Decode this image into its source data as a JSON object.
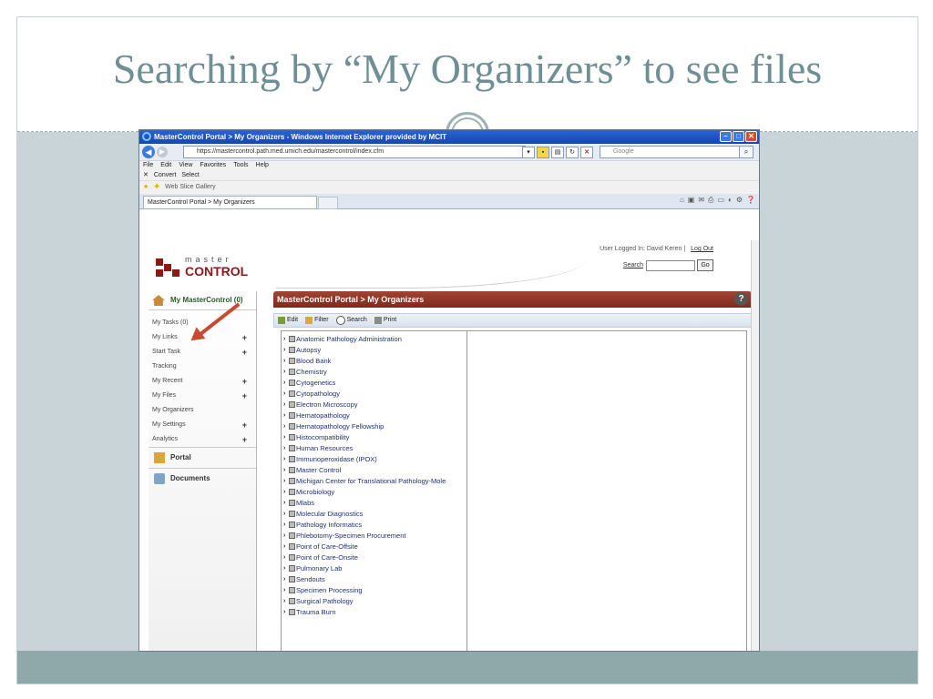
{
  "slide": {
    "title": "Searching by “My Organizers” to see files"
  },
  "browser": {
    "window_title": "MasterControl Portal > My Organizers - Windows Internet Explorer provided by MCIT",
    "url": "https://mastercontrol.path.med.umich.edu/mastercontrol/index.cfm",
    "search_placeholder": "Google",
    "menu": [
      "File",
      "Edit",
      "View",
      "Favorites",
      "Tools",
      "Help"
    ],
    "command_items": [
      "Convert",
      "Select"
    ],
    "favorites": [
      "Web Slice Gallery"
    ],
    "tab_label": "MasterControl Portal > My Organizers"
  },
  "portal": {
    "logo_top": "master",
    "logo_bottom": "CONTROL",
    "user_logged_in": "User Logged In: David Keren",
    "logout": "Log Out",
    "search_link": "Search",
    "go": "Go",
    "sidebar_header": "My MasterControl (0)",
    "sidebar_items": [
      {
        "label": "My Tasks (0)",
        "plus": false
      },
      {
        "label": "My Links",
        "plus": true
      },
      {
        "label": "Start Task",
        "plus": true
      },
      {
        "label": "Tracking",
        "plus": false
      },
      {
        "label": "My Recent",
        "plus": true
      },
      {
        "label": "My Files",
        "plus": true
      },
      {
        "label": "My Organizers",
        "plus": false
      },
      {
        "label": "My Settings",
        "plus": true
      },
      {
        "label": "Analytics",
        "plus": true
      }
    ],
    "sections": [
      "Portal",
      "Documents"
    ],
    "main_title": "MasterControl Portal > My Organizers",
    "toolbar": [
      "Edit",
      "Filter",
      "Search",
      "Print"
    ],
    "folders": [
      "Anatomic Pathology Administration",
      "Autopsy",
      "Blood Bank",
      "Chemistry",
      "Cytogenetics",
      "Cytopathology",
      "Electron Microscopy",
      "Hematopathology",
      "Hematopathology Fellowship",
      "Histocompatibility",
      "Human Resources",
      "Immunoperoxidase (IPOX)",
      "Master Control",
      "Michigan Center for Translational Pathology-Mole",
      "Microbiology",
      "Mlabs",
      "Molecular Diagnostics",
      "Pathology Informatics",
      "Phlebotomy-Specimen Procurement",
      "Point of Care-Offsite",
      "Point of Care-Onsite",
      "Pulmonary Lab",
      "Sendouts",
      "Specimen Processing",
      "Surgical Pathology",
      "Trauma Burn"
    ]
  },
  "colors": {
    "title": "#6e8f94",
    "band": "#c9d4d8",
    "footer": "#8fa9ab",
    "header_bar": "#8b2d21",
    "arrow": "#c84a30"
  }
}
